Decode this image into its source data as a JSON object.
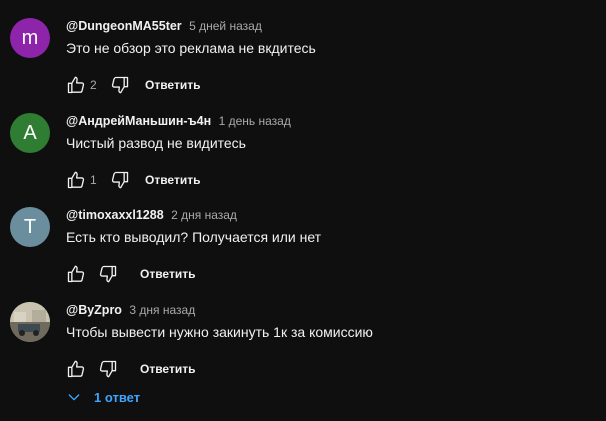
{
  "colors": {
    "background": "#0f0f0f",
    "text_primary": "#f1f1f1",
    "text_secondary": "#aaaaaa",
    "link_blue": "#3ea6ff"
  },
  "comments": [
    {
      "avatar_letter": "m",
      "avatar_color": "#8e24aa",
      "author": "@DungeonMA55ter",
      "time": "5 дней назад",
      "text": "Это не обзор это реклама не вкдитесь",
      "likes": "2",
      "reply_label": "Ответить"
    },
    {
      "avatar_letter": "А",
      "avatar_color": "#2e7d32",
      "author": "@АндрейМаньшин-ъ4н",
      "time": "1 день назад",
      "text": "Чистый развод не видитесь",
      "likes": "1",
      "reply_label": "Ответить"
    },
    {
      "avatar_letter": "T",
      "avatar_color": "#6b8e9e",
      "author": "@timoxaxxl1288",
      "time": "2 дня назад",
      "text": "Есть кто выводил? Получается или нет",
      "likes": "",
      "reply_label": "Ответить"
    },
    {
      "avatar_letter": "",
      "avatar_color": "#9aa0a6",
      "author": "@ByZpro",
      "time": "3 дня назад",
      "text": "Чтобы вывести нужно закинуть 1к за комиссию",
      "likes": "",
      "reply_label": "Ответить"
    }
  ],
  "replies_toggle": {
    "label": "1 ответ",
    "icon": "chevron-down-icon"
  }
}
